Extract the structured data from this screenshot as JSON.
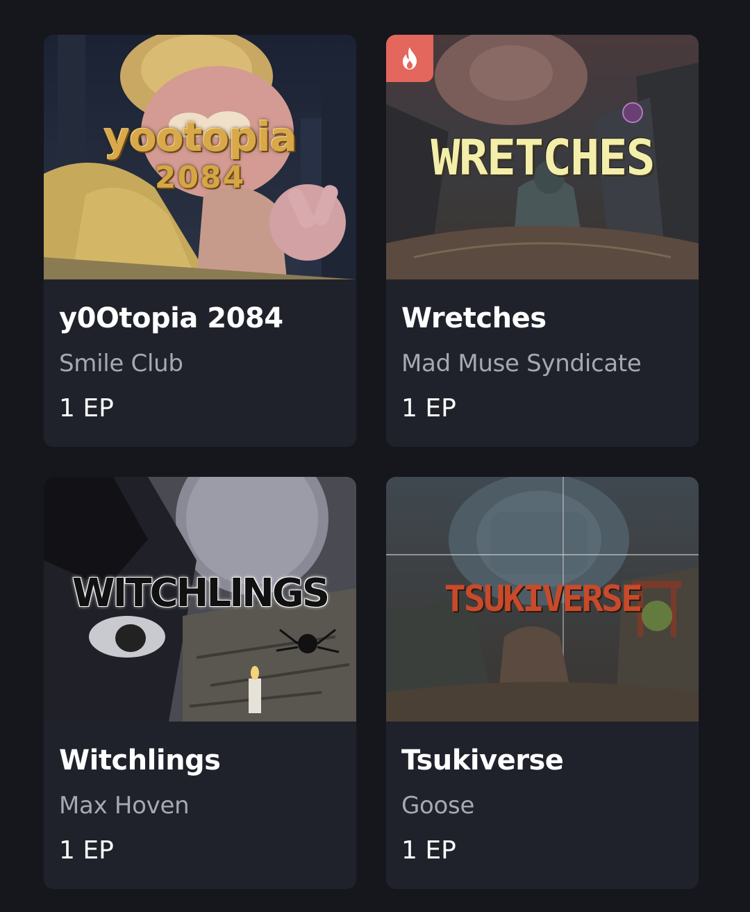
{
  "colors": {
    "background": "#15171d",
    "card": "#1f222a",
    "title": "#ffffff",
    "subtitle": "#a6a9b2",
    "hot_badge": "#e3675c"
  },
  "cards": [
    {
      "cover_text": "yootopia",
      "cover_subtext": "2084",
      "title": "y0Otopia 2084",
      "creator": "Smile Club",
      "price": "1 EP",
      "badge_icon": null
    },
    {
      "cover_text": "WRETCHES",
      "title": "Wretches",
      "creator": "Mad Muse Syndicate",
      "price": "1 EP",
      "badge_icon": "fire-icon"
    },
    {
      "cover_text": "WITCHLINGS",
      "title": "Witchlings",
      "creator": "Max Hoven",
      "price": "1 EP",
      "badge_icon": null
    },
    {
      "cover_text": "TSUKIVERSE",
      "title": "Tsukiverse",
      "creator": "Goose",
      "price": "1 EP",
      "badge_icon": null
    }
  ]
}
